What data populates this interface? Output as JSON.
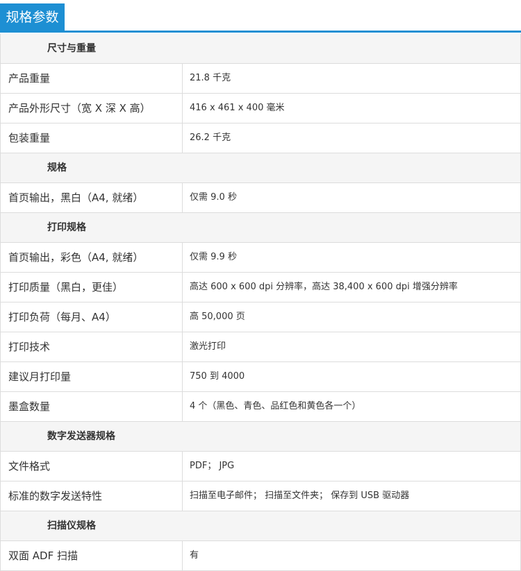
{
  "header": {
    "title": "规格参数"
  },
  "sections": [
    {
      "title": "尺寸与重量",
      "rows": [
        {
          "label": "产品重量",
          "value": "21.8 千克"
        },
        {
          "label": "产品外形尺寸（宽 X 深 X 高）",
          "value": "416 x 461 x 400 毫米"
        },
        {
          "label": "包装重量",
          "value": "26.2 千克"
        }
      ]
    },
    {
      "title": "规格",
      "rows": [
        {
          "label": "首页输出，黑白（A4, 就绪）",
          "value": "仅需 9.0 秒"
        }
      ]
    },
    {
      "title": "打印规格",
      "rows": [
        {
          "label": "首页输出，彩色（A4, 就绪）",
          "value": "仅需 9.9 秒"
        },
        {
          "label": "打印质量（黑白，更佳）",
          "value": "高达 600 x 600 dpi 分辨率，高达 38,400 x 600 dpi 增强分辨率"
        },
        {
          "label": "打印负荷（每月、A4）",
          "value": "高 50,000 页"
        },
        {
          "label": "打印技术",
          "value": "激光打印"
        },
        {
          "label": "建议月打印量",
          "value": "750 到 4000"
        },
        {
          "label": "墨盒数量",
          "value": "4 个（黑色、青色、品红色和黄色各一个）"
        }
      ]
    },
    {
      "title": "数字发送器规格",
      "rows": [
        {
          "label": "文件格式",
          "value": "PDF； JPG"
        },
        {
          "label": "标准的数字发送特性",
          "value": "扫描至电子邮件； 扫描至文件夹； 保存到 USB 驱动器"
        }
      ]
    },
    {
      "title": "扫描仪规格",
      "rows": [
        {
          "label": "双面 ADF 扫描",
          "value": "有"
        }
      ]
    }
  ]
}
